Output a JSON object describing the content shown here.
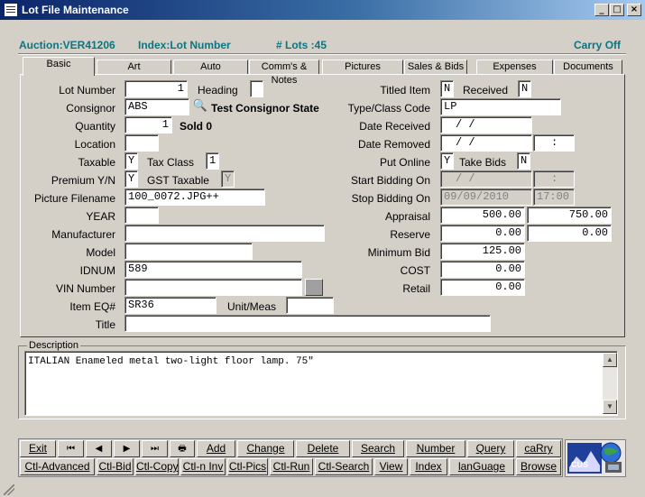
{
  "window": {
    "title": "Lot File Maintenance",
    "min": "_",
    "max": "□",
    "close": "×"
  },
  "header": {
    "auction": "Auction:VER41206",
    "index": "Index:Lot Number",
    "lots": "# Lots :45",
    "carry": "Carry Off"
  },
  "tabs": [
    "Basic",
    "Art",
    "Auto",
    "Comm's & Notes",
    "Pictures",
    "Sales & Bids",
    "Expenses",
    "Documents"
  ],
  "left": {
    "lot_number": {
      "label": "Lot Number",
      "value": "1"
    },
    "heading": {
      "label": "Heading",
      "value": ""
    },
    "consignor": {
      "label": "Consignor",
      "value": "ABS",
      "name": "Test Consignor State"
    },
    "quantity": {
      "label": "Quantity",
      "value": "1",
      "sold": "Sold 0"
    },
    "location": {
      "label": "Location",
      "value": ""
    },
    "taxable": {
      "label": "Taxable",
      "value": "Y"
    },
    "tax_class": {
      "label": "Tax Class",
      "value": "1"
    },
    "premium": {
      "label": "Premium Y/N",
      "value": "Y"
    },
    "gst": {
      "label": "GST Taxable",
      "value": "Y"
    },
    "picture": {
      "label": "Picture Filename",
      "value": "100_0072.JPG++"
    },
    "year": {
      "label": "YEAR",
      "value": ""
    },
    "manufacturer": {
      "label": "Manufacturer",
      "value": ""
    },
    "model": {
      "label": "Model",
      "value": ""
    },
    "idnum": {
      "label": "IDNUM",
      "value": "589"
    },
    "vin": {
      "label": "VIN Number",
      "value": ""
    },
    "item_eq": {
      "label": "Item EQ#",
      "value": "SR36"
    },
    "unit_meas": {
      "label": "Unit/Meas",
      "value": ""
    },
    "title": {
      "label": "Title",
      "value": ""
    }
  },
  "right": {
    "titled": {
      "label": "Titled Item",
      "value": "N"
    },
    "received": {
      "label": "Received",
      "value": "N"
    },
    "type_class": {
      "label": "Type/Class Code",
      "value": "LP"
    },
    "date_received": {
      "label": "Date Received",
      "value": "/  /"
    },
    "date_removed": {
      "label": "Date Removed",
      "value": "/  /",
      "time": ":"
    },
    "put_online": {
      "label": "Put Online",
      "value": "Y"
    },
    "take_bids": {
      "label": "Take Bids",
      "value": "N"
    },
    "start_bidding": {
      "label": "Start Bidding On",
      "value": "/  /",
      "time": ":"
    },
    "stop_bidding": {
      "label": "Stop Bidding On",
      "value": "09/09/2010",
      "time": "17:00"
    },
    "appraisal": {
      "label": "Appraisal",
      "low": "500.00",
      "high": "750.00"
    },
    "reserve": {
      "label": "Reserve",
      "low": "0.00",
      "high": "0.00"
    },
    "minimum_bid": {
      "label": "Minimum Bid",
      "value": "125.00"
    },
    "cost": {
      "label": "COST",
      "value": "0.00"
    },
    "retail": {
      "label": "Retail",
      "value": "0.00"
    }
  },
  "description": {
    "label": "Description",
    "value": "ITALIAN Enameled metal two-light floor lamp.  75\""
  },
  "toolbar": {
    "row1": [
      "Exit",
      "⏮",
      "◀",
      "▶",
      "⏭",
      "🖶",
      "Add",
      "Change",
      "Delete",
      "Search",
      "Number",
      "Query",
      "caRry"
    ],
    "row2": [
      "Ctl-Advanced",
      "Ctl-Bid",
      "Ctl-Copy",
      "Ctl-n Inv",
      "Ctl-Pics",
      "Ctl-Run",
      "Ctl-Search",
      "View",
      "Index",
      "lanGuage",
      "Browse"
    ]
  },
  "logo": {
    "text": "CUS"
  }
}
